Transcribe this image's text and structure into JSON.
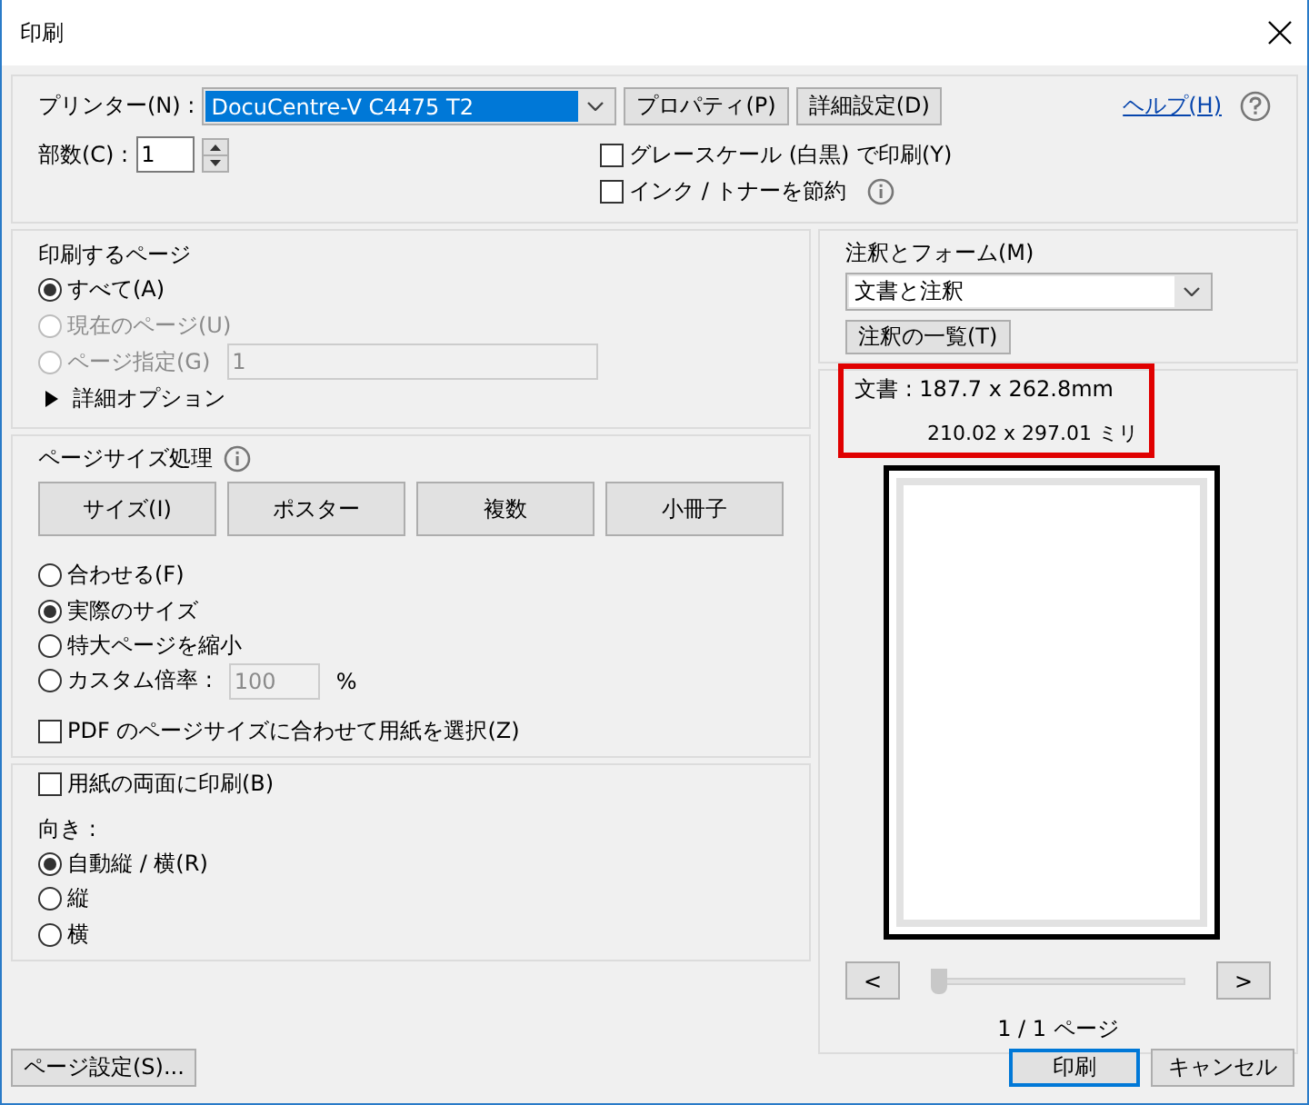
{
  "window": {
    "title": "印刷"
  },
  "printer": {
    "label": "プリンター(N) :",
    "value": "DocuCentre-V C4475 T2",
    "focused": true
  },
  "top_buttons": [
    "プロパティ(P)",
    "詳細設定(D)"
  ],
  "help": {
    "label": "ヘルプ(H)"
  },
  "copies": {
    "label": "部数(C) :",
    "value": "1"
  },
  "options": [
    {
      "label": "グレースケール (白黒) で印刷(Y)",
      "checked": false,
      "info": false
    },
    {
      "label": "インク / トナーを節約",
      "checked": false,
      "info": true
    }
  ],
  "pages": {
    "title": "印刷するページ",
    "choices": [
      {
        "label": "すべて(A)",
        "selected": true,
        "disabled": false
      },
      {
        "label": "現在のページ(U)",
        "selected": false,
        "disabled": true
      },
      {
        "label": "ページ指定(G)",
        "selected": false,
        "disabled": true,
        "value": "1"
      }
    ],
    "more": {
      "label": "詳細オプション",
      "expanded": false
    }
  },
  "page_sizing": {
    "title": "ページサイズ処理",
    "modes": [
      "サイズ(I)",
      "ポスター",
      "複数",
      "小冊子"
    ],
    "choices": [
      {
        "label": "合わせる(F)",
        "selected": false,
        "disabled": false
      },
      {
        "label": "実際のサイズ",
        "selected": true,
        "disabled": false
      },
      {
        "label": "特大ページを縮小",
        "selected": false,
        "disabled": false
      },
      {
        "label": "カスタム倍率 :",
        "selected": false,
        "disabled": false,
        "value": "100",
        "unit": "%"
      }
    ],
    "paper_option": {
      "label": "PDF のページサイズに合わせて用紙を選択(Z)",
      "checked": false
    }
  },
  "duplex": {
    "label": "用紙の両面に印刷(B)",
    "checked": false
  },
  "orientation": {
    "title": "向き :",
    "choices": [
      {
        "label": "自動縦 / 横(R)",
        "selected": true,
        "disabled": false
      },
      {
        "label": "縦",
        "selected": false,
        "disabled": false
      },
      {
        "label": "横",
        "selected": false,
        "disabled": false
      }
    ]
  },
  "annotations": {
    "label": "注釈とフォーム(M)",
    "value": "文書と注釈",
    "button": "注釈の一覧(T)"
  },
  "preview": {
    "document_size": "文書 : 187.7 x 262.8mm",
    "paper_size": "210.02 x 297.01 ミリ",
    "highlighted": true,
    "prev": "<",
    "next": ">",
    "level": 0,
    "page_count": "1 / 1 ページ"
  },
  "page_setup": "ページ設定(S)...",
  "buttons": [
    {
      "label": "印刷",
      "default": true
    },
    {
      "label": "キャンセル",
      "default": false
    }
  ]
}
